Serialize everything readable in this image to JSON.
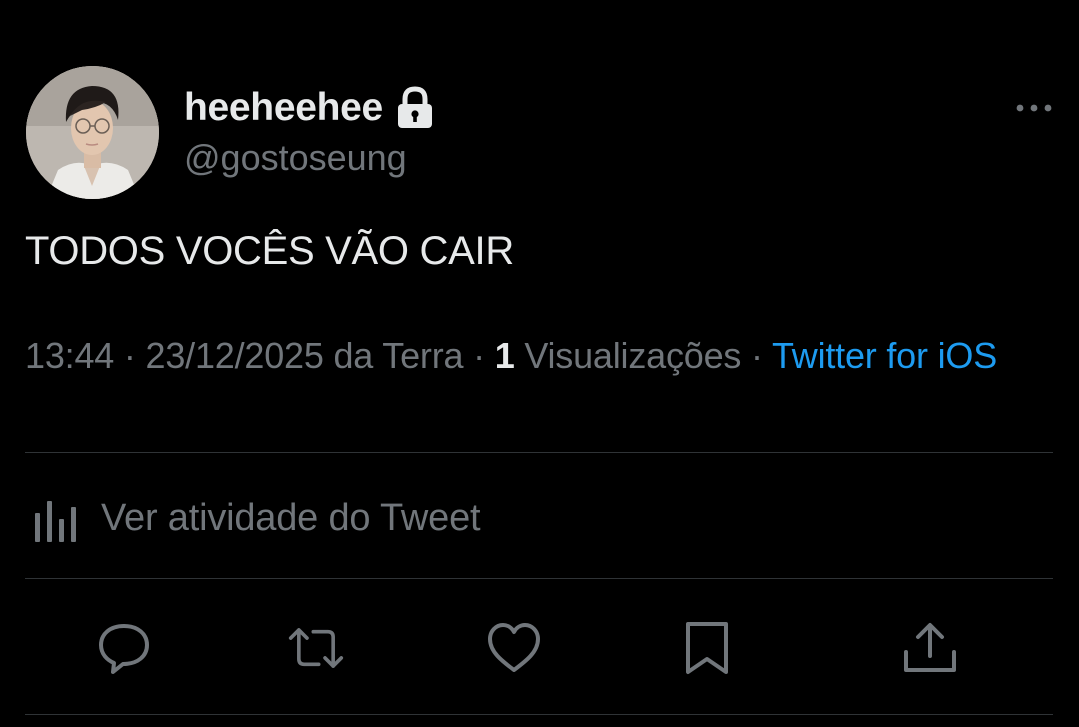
{
  "tweet": {
    "author": {
      "display_name": "heeheehee",
      "handle": "@gostoseung",
      "protected_icon": "lock-icon",
      "avatar": "profile-photo"
    },
    "text": "TODOS VOCÊS VÃO CAIR",
    "meta": {
      "time": "13:44",
      "separator1": " · ",
      "date": "23/12/2025",
      "location": " da Terra",
      "separator2": " · ",
      "views_count": "1",
      "views_label": " Visualizações",
      "separator3": " · ",
      "source": "Twitter for iOS"
    },
    "activity_label": "Ver atividade do Tweet"
  },
  "icons": {
    "more": "more-options-icon",
    "activity": "bar-chart-icon",
    "actions": [
      "reply-icon",
      "retweet-icon",
      "like-icon",
      "bookmark-icon",
      "share-icon"
    ]
  },
  "colors": {
    "background": "#000000",
    "primary_text": "#e7e9ea",
    "secondary_text": "#71767b",
    "accent": "#1d9bf0",
    "divider": "#2f3336"
  }
}
